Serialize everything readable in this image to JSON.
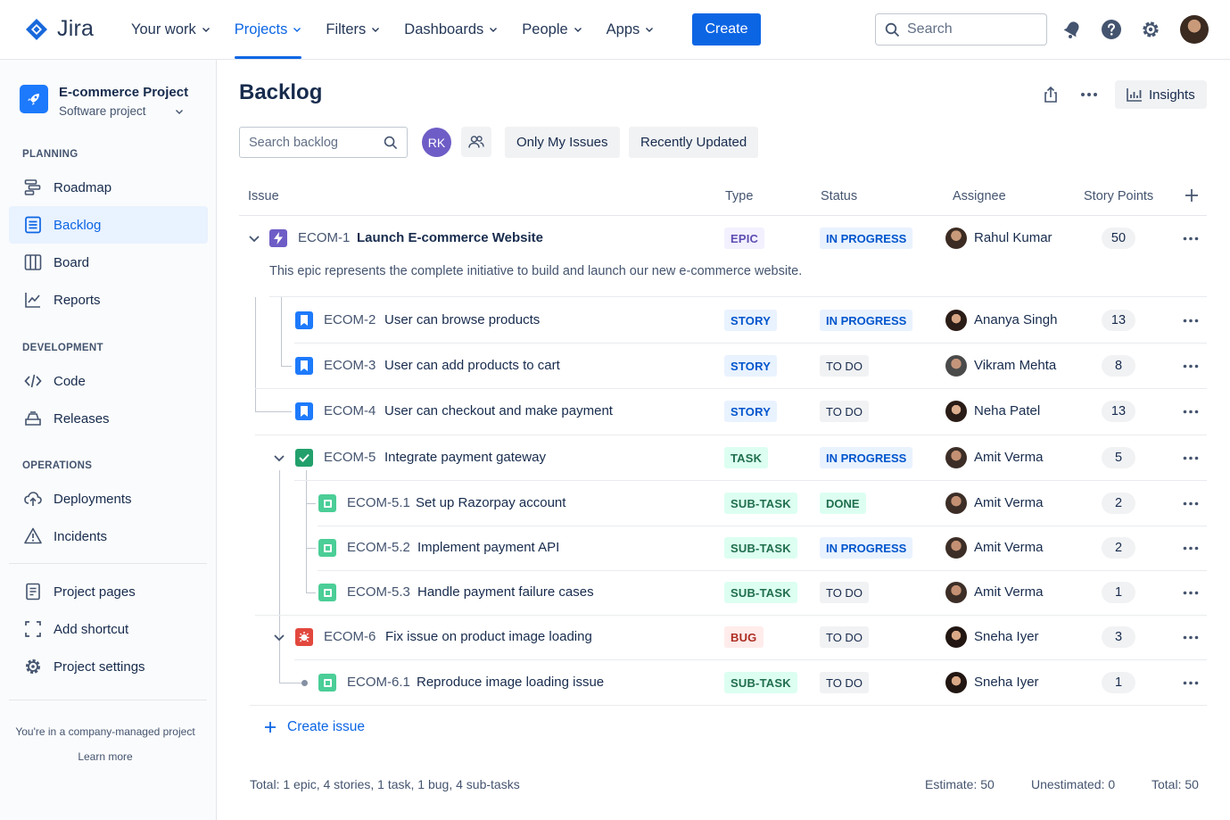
{
  "app": {
    "name": "Jira"
  },
  "nav": {
    "items": [
      {
        "label": "Your work",
        "active": false
      },
      {
        "label": "Projects",
        "active": true
      },
      {
        "label": "Filters",
        "active": false
      },
      {
        "label": "Dashboards",
        "active": false
      },
      {
        "label": "People",
        "active": false
      },
      {
        "label": "Apps",
        "active": false
      }
    ],
    "create_label": "Create",
    "search_placeholder": "Search"
  },
  "sidebar": {
    "project_name": "E-commerce Project",
    "project_type": "Software project",
    "sections": {
      "planning": "PLANNING",
      "development": "DEVELOPMENT",
      "operations": "OPERATIONS"
    },
    "planning_items": [
      "Roadmap",
      "Backlog",
      "Board",
      "Reports"
    ],
    "development_items": [
      "Code",
      "Releases"
    ],
    "operations_items": [
      "Deployments",
      "Incidents"
    ],
    "other_items": [
      "Project pages",
      "Add shortcut",
      "Project settings"
    ],
    "active_item": "Backlog",
    "footer_text": "You're in a company-managed project",
    "footer_link": "Learn more"
  },
  "page": {
    "title": "Backlog",
    "insights_label": "Insights",
    "search_placeholder": "Search backlog",
    "avatar_initials": "RK",
    "filters": [
      "Only My Issues",
      "Recently Updated"
    ]
  },
  "columns": [
    "Issue",
    "Type",
    "Status",
    "Assignee",
    "Story Points"
  ],
  "issues": [
    {
      "key": "ECOM-1",
      "summary": "Launch E-commerce Website",
      "type": "EPIC",
      "status": "IN PROGRESS",
      "assignee": "Rahul Kumar",
      "points": "50",
      "description": "This epic represents the complete initiative to build and launch our new e-commerce website."
    },
    {
      "key": "ECOM-2",
      "summary": "User can browse products",
      "type": "STORY",
      "status": "IN PROGRESS",
      "assignee": "Ananya Singh",
      "points": "13"
    },
    {
      "key": "ECOM-3",
      "summary": "User can add products to cart",
      "type": "STORY",
      "status": "TO DO",
      "assignee": "Vikram Mehta",
      "points": "8"
    },
    {
      "key": "ECOM-4",
      "summary": "User can checkout and make payment",
      "type": "STORY",
      "status": "TO DO",
      "assignee": "Neha Patel",
      "points": "13"
    },
    {
      "key": "ECOM-5",
      "summary": "Integrate payment gateway",
      "type": "TASK",
      "status": "IN PROGRESS",
      "assignee": "Amit Verma",
      "points": "5"
    },
    {
      "key": "ECOM-5.1",
      "summary": "Set up Razorpay account",
      "type": "SUB-TASK",
      "status": "DONE",
      "assignee": "Amit Verma",
      "points": "2"
    },
    {
      "key": "ECOM-5.2",
      "summary": "Implement payment API",
      "type": "SUB-TASK",
      "status": "IN PROGRESS",
      "assignee": "Amit Verma",
      "points": "2"
    },
    {
      "key": "ECOM-5.3",
      "summary": "Handle payment failure cases",
      "type": "SUB-TASK",
      "status": "TO DO",
      "assignee": "Amit Verma",
      "points": "1"
    },
    {
      "key": "ECOM-6",
      "summary": "Fix issue on product image loading",
      "type": "BUG",
      "status": "TO DO",
      "assignee": "Sneha Iyer",
      "points": "3"
    },
    {
      "key": "ECOM-6.1",
      "summary": "Reproduce image loading issue",
      "type": "SUB-TASK",
      "status": "TO DO",
      "assignee": "Sneha Iyer",
      "points": "1"
    }
  ],
  "create_issue_label": "Create issue",
  "footer": {
    "summary": "Total: 1 epic, 4 stories, 1 task, 1 bug, 4 sub-tasks",
    "estimate": "Estimate: 50",
    "unestimated": "Unestimated: 0",
    "total": "Total: 50"
  },
  "colors": {
    "accent": "#0c66e4",
    "epic": "#6e5dc6",
    "story": "#1d7afc",
    "task": "#22a06b",
    "subtask": "#4bce97",
    "bug": "#e2483d"
  }
}
